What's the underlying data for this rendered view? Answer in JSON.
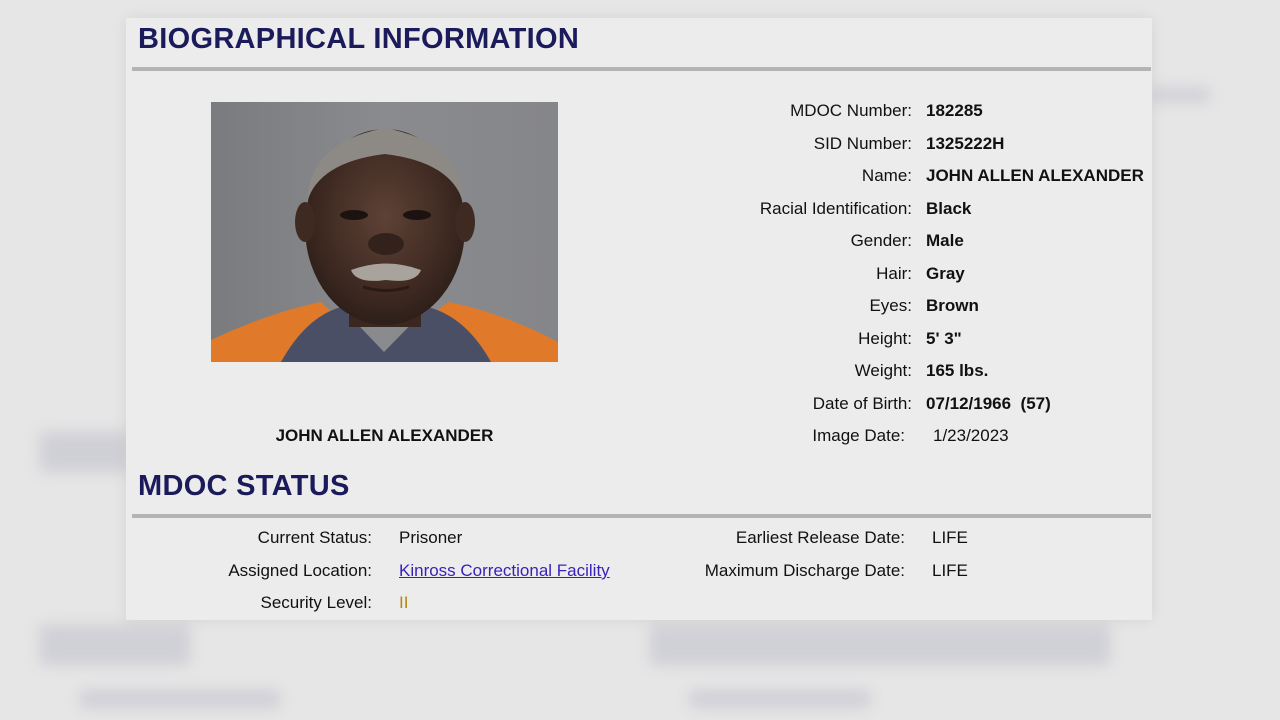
{
  "bio": {
    "heading": "BIOGRAPHICAL INFORMATION",
    "photo_caption": "JOHN ALLEN ALEXANDER",
    "rows": [
      {
        "label": "MDOC Number:",
        "value": "182285"
      },
      {
        "label": "SID Number:",
        "value": "1325222H"
      },
      {
        "label": "Name:",
        "value": "JOHN ALLEN ALEXANDER"
      },
      {
        "label": "Racial Identification:",
        "value": "Black"
      },
      {
        "label": "Gender:",
        "value": "Male"
      },
      {
        "label": "Hair:",
        "value": "Gray"
      },
      {
        "label": "Eyes:",
        "value": "Brown"
      },
      {
        "label": "Height:",
        "value": "5' 3\""
      },
      {
        "label": "Weight:",
        "value": "165 lbs."
      },
      {
        "label": "Date of Birth:",
        "value": "07/12/1966  (57)"
      },
      {
        "label": "Image Date:",
        "value": "1/23/2023"
      }
    ]
  },
  "status": {
    "heading": "MDOC STATUS",
    "current_status_label": "Current Status:",
    "current_status_value": "Prisoner",
    "assigned_location_label": "Assigned Location:",
    "assigned_location_value": "Kinross Correctional Facility",
    "security_level_label": "Security Level:",
    "security_level_value": "II",
    "earliest_release_label": "Earliest Release Date:",
    "earliest_release_value": "LIFE",
    "max_discharge_label": "Maximum Discharge Date:",
    "max_discharge_value": "LIFE"
  },
  "colors": {
    "heading": "#1b1a5a",
    "link": "#3a1fb8",
    "security_level": "#b8860b"
  }
}
